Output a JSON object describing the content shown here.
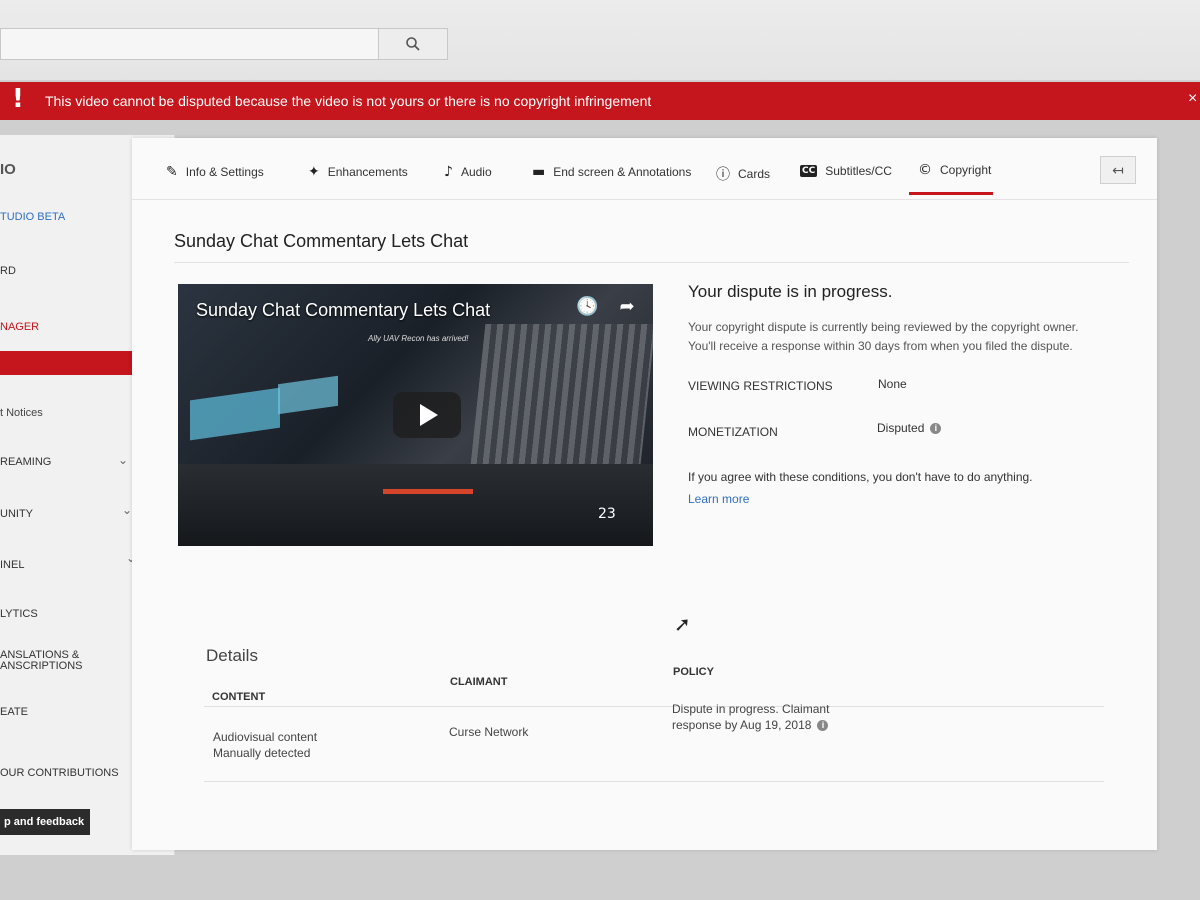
{
  "search": {
    "placeholder": "",
    "button_icon": "search-icon"
  },
  "banner": {
    "icon": "!",
    "message": "This video cannot be disputed because the video is not yours or there is no copyright infringement",
    "close": "×",
    "color": "#c4161c"
  },
  "sidebar": {
    "items": [
      {
        "label": "IO"
      },
      {
        "label": "TUDIO BETA"
      },
      {
        "label": "RD"
      },
      {
        "label": "NAGER"
      },
      {
        "label": "t Notices"
      },
      {
        "label": "REAMING"
      },
      {
        "label": "UNITY"
      },
      {
        "label": "INEL"
      },
      {
        "label": "LYTICS"
      },
      {
        "label": "ANSLATIONS &"
      },
      {
        "label": "ANSCRIPTIONS"
      },
      {
        "label": "EATE"
      },
      {
        "label": "OUR CONTRIBUTIONS"
      }
    ],
    "help_button": "p and feedback"
  },
  "tabs": [
    {
      "label": "Info & Settings",
      "icon": "pencil-icon"
    },
    {
      "label": "Enhancements",
      "icon": "magic-wand-icon"
    },
    {
      "label": "Audio",
      "icon": "music-note-icon"
    },
    {
      "label": "End screen & Annotations",
      "icon": "end-screen-icon"
    },
    {
      "label": "Cards",
      "icon": "info-icon"
    },
    {
      "label": "Subtitles/CC",
      "icon": "cc-icon"
    },
    {
      "label": "Copyright",
      "icon": "copyright-icon",
      "active": true
    }
  ],
  "video": {
    "title": "Sunday Chat Commentary Lets Chat",
    "player_title": "Sunday Chat Commentary Lets Chat",
    "overlay_text": "Ally UAV Recon has arrived!",
    "hud_count": "23"
  },
  "dispute": {
    "heading": "Your dispute is in progress.",
    "description": "Your copyright dispute is currently being reviewed by the copyright owner. You'll receive a response within 30 days from when you filed the dispute.",
    "viewing_label": "VIEWING RESTRICTIONS",
    "viewing_value": "None",
    "monetization_label": "MONETIZATION",
    "monetization_value": "Disputed",
    "agree_text": "If you agree with these conditions, you don't have to do anything.",
    "learn_more": "Learn more"
  },
  "details": {
    "title": "Details",
    "columns": [
      "CONTENT",
      "CLAIMANT",
      "POLICY"
    ],
    "row": {
      "content_line1": "Audiovisual content",
      "content_line2": "Manually detected",
      "claimant": "Curse Network",
      "policy_line1": "Dispute in progress. Claimant",
      "policy_line2": "response by Aug 19, 2018"
    }
  }
}
